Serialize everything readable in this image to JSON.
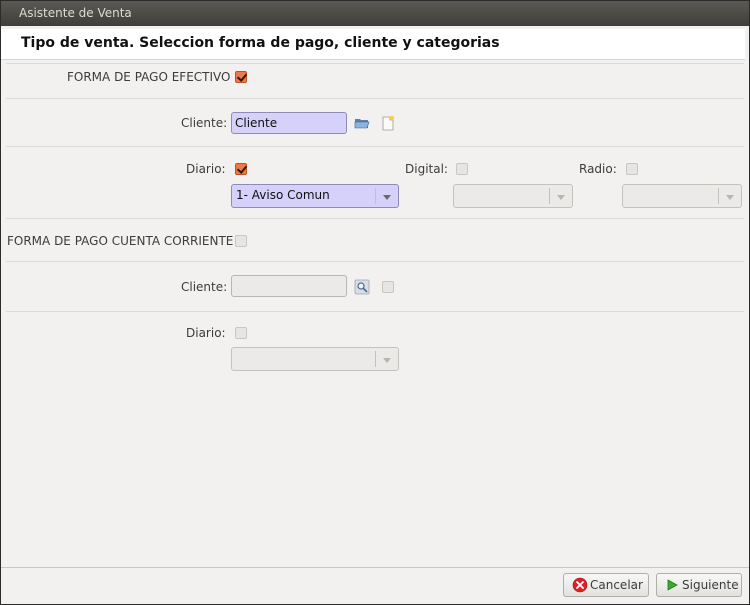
{
  "window": {
    "title": "Asistente de Venta"
  },
  "header": {
    "title": "Tipo de venta. Seleccion forma de pago, cliente y categorias"
  },
  "efectivo": {
    "label": "FORMA DE PAGO EFECTIVO",
    "checked": true,
    "cliente_label": "Cliente:",
    "cliente_value": "Cliente",
    "diario_label": "Diario:",
    "diario_checked": true,
    "diario_combo_value": "1- Aviso Comun",
    "digital_label": "Digital:",
    "digital_checked": false,
    "radio_label": "Radio:",
    "radio_checked": false
  },
  "cuenta_corriente": {
    "label": "FORMA DE PAGO CUENTA CORRIENTE",
    "checked": false,
    "cliente_label": "Cliente:",
    "cliente_value": "",
    "diario_label": "Diario:",
    "diario_checked": false
  },
  "footer": {
    "cancel_label": "Cancelar",
    "next_label": "Siguiente"
  },
  "icons": {
    "open_folder": "folder-open-icon",
    "new_document": "new-document-icon",
    "search": "search-icon",
    "cancel": "cancel-icon",
    "next": "arrow-right-icon"
  },
  "colors": {
    "checkbox_checked": "#f07746",
    "active_field": "#d5d1fa",
    "cancel_icon": "#d9232a",
    "next_icon": "#3aa92e"
  }
}
